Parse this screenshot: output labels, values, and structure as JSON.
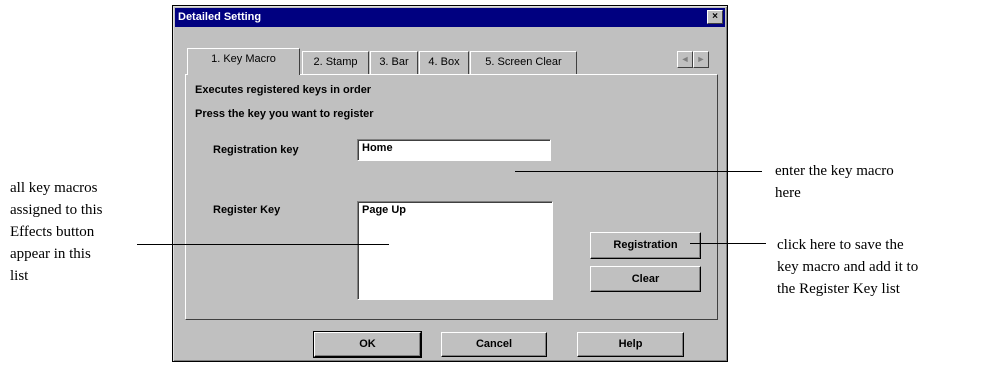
{
  "dialog": {
    "title": "Detailed Setting",
    "close_glyph": "×",
    "tabs": [
      {
        "label": "1. Key Macro",
        "active": true
      },
      {
        "label": "2. Stamp",
        "active": false
      },
      {
        "label": "3. Bar",
        "active": false
      },
      {
        "label": "4. Box",
        "active": false
      },
      {
        "label": "5. Screen Clear",
        "active": false
      }
    ],
    "scroll_left_icon": "◄",
    "scroll_right_icon": "►",
    "panel": {
      "line1": "Executes registered keys in order",
      "line2": "Press the key you want to register",
      "registration_key_label": "Registration key",
      "registration_key_value": "Home",
      "register_key_label": "Register Key",
      "register_key_items": [
        "Page Up"
      ],
      "registration_button": "Registration",
      "clear_button": "Clear"
    },
    "footer": {
      "ok": "OK",
      "cancel": "Cancel",
      "help": "Help"
    }
  },
  "annotations": {
    "left": [
      "all key macros",
      "assigned to this",
      "Effects button",
      "appear in this",
      "list"
    ],
    "right_top": [
      "enter the key macro",
      "here"
    ],
    "right_bottom": [
      "click here to save the",
      "key macro and add it to",
      "the Register Key list"
    ]
  }
}
